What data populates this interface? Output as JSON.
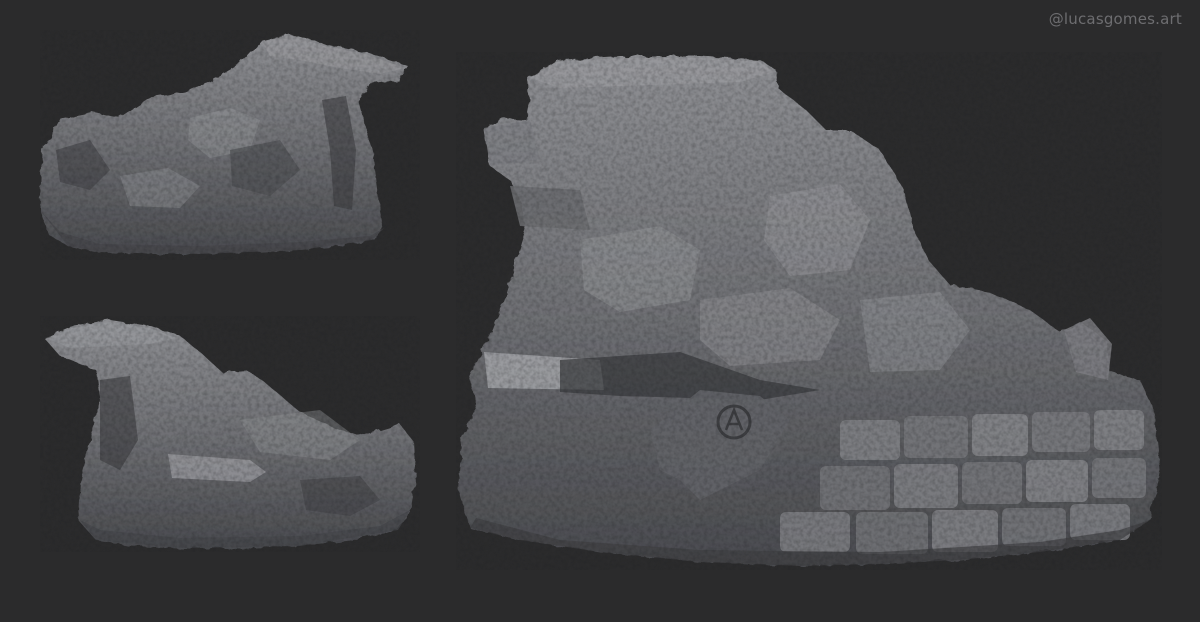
{
  "watermark": "@lucasgomes.art",
  "colors": {
    "background": "#2b2b2c",
    "clay_light": "#8d8e92",
    "clay_mid": "#6c6d71",
    "clay_dark": "#45464a",
    "clay_shadow": "#303134",
    "watermark": "#6d6d70"
  },
  "views": [
    {
      "name": "sculpt-view-top-left"
    },
    {
      "name": "sculpt-view-bottom-left"
    },
    {
      "name": "sculpt-view-main"
    }
  ]
}
